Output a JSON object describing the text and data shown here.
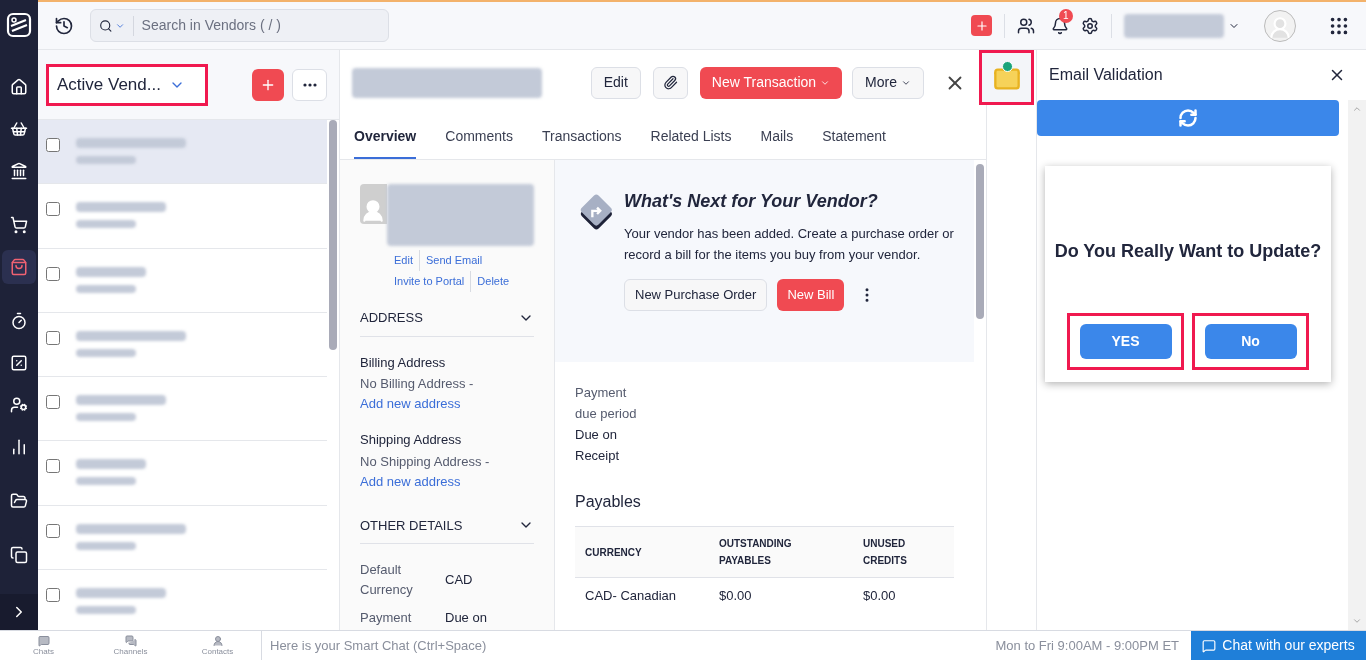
{
  "nav_rail": {
    "items": [
      {
        "selected": false
      },
      {
        "selected": false
      },
      {
        "selected": false
      },
      {
        "selected": false
      },
      {
        "selected": true
      },
      {
        "selected": false
      },
      {
        "selected": false
      },
      {
        "selected": false
      },
      {
        "selected": false
      },
      {
        "selected": false
      },
      {
        "selected": false
      }
    ]
  },
  "top_bar": {
    "search": {
      "placeholder": "Search in Vendors ( / )"
    },
    "notification_count": "1"
  },
  "vendor_list": {
    "title": "Active Vend...",
    "highlighted": true,
    "rows": [
      {
        "selected": true,
        "checked": false
      },
      {
        "selected": false,
        "checked": false
      },
      {
        "selected": false,
        "checked": false
      },
      {
        "selected": false,
        "checked": false
      },
      {
        "selected": false,
        "checked": false
      },
      {
        "selected": false,
        "checked": false
      },
      {
        "selected": false,
        "checked": false
      },
      {
        "selected": false,
        "checked": false
      }
    ]
  },
  "detail": {
    "buttons": {
      "edit": "Edit",
      "new_transaction": "New Transaction",
      "more": "More"
    },
    "tabs": [
      {
        "label": "Overview",
        "selected": true
      },
      {
        "label": "Comments",
        "selected": false
      },
      {
        "label": "Transactions",
        "selected": false
      },
      {
        "label": "Related Lists",
        "selected": false
      },
      {
        "label": "Mails",
        "selected": false
      },
      {
        "label": "Statement",
        "selected": false
      }
    ],
    "contact_links": [
      "Edit",
      "Send Email",
      "Invite to Portal",
      "Delete"
    ],
    "address": {
      "heading": "ADDRESS",
      "billing_label": "Billing Address",
      "billing_value": "No Billing Address -",
      "billing_link": "Add new address",
      "shipping_label": "Shipping Address",
      "shipping_value": "No Shipping Address -",
      "shipping_link": "Add new address"
    },
    "other_details": {
      "heading": "OTHER DETAILS",
      "fields": [
        {
          "label": "Default Currency",
          "value": "CAD"
        },
        {
          "label": "Payment",
          "value": "Due on"
        }
      ]
    },
    "whats_next": {
      "title": "What's Next for Your Vendor?",
      "text": "Your vendor has been added. Create a purchase order or record a bill for the items you buy from your vendor.",
      "buttons": [
        "New Purchase Order",
        "New Bill"
      ]
    },
    "payment_due": {
      "label": "Payment due period",
      "value": "Due on Receipt"
    },
    "payables": {
      "heading": "Payables",
      "columns": [
        "CURRENCY",
        "OUTSTANDING PAYABLES",
        "UNUSED CREDITS"
      ],
      "rows": [
        [
          "CAD- Canadian",
          "$0.00",
          "$0.00"
        ]
      ]
    }
  },
  "side_strip": {
    "email_icon_highlighted": true
  },
  "email_validation": {
    "title": "Email Validation",
    "question": "Do You Really Want to Update?",
    "buttons": [
      {
        "label": "YES",
        "highlighted": true
      },
      {
        "label": "No",
        "highlighted": true
      }
    ]
  },
  "bottom_bar": {
    "tabs": [
      "Chats",
      "Channels",
      "Contacts"
    ],
    "smart_chat_placeholder": "Here is your Smart Chat (Ctrl+Space)",
    "hours": "Mon to Fri 9:00AM - 9:00PM ET",
    "chat_button": "Chat with our experts"
  }
}
